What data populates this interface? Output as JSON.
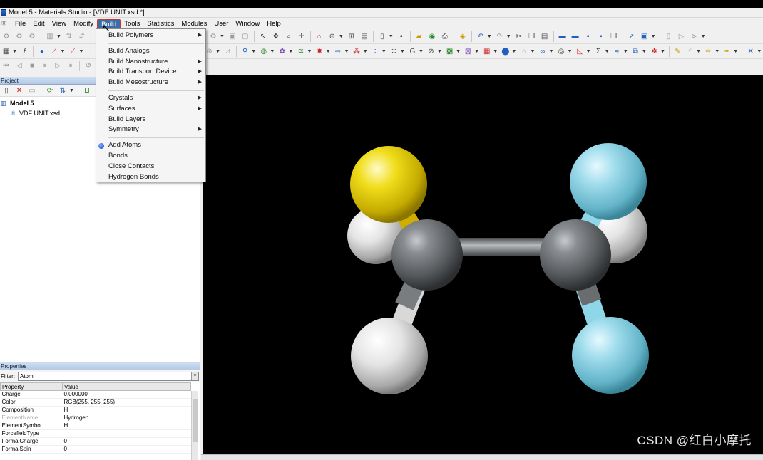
{
  "window": {
    "title": "Model 5 - Materials Studio - [VDF UNIT.xsd *]"
  },
  "menubar": {
    "items": [
      "File",
      "Edit",
      "View",
      "Modify",
      "Build",
      "Tools",
      "Statistics",
      "Modules",
      "User",
      "Window",
      "Help"
    ],
    "active": "Build"
  },
  "build_menu": {
    "items": [
      {
        "label": "Build Polymers",
        "submenu": true
      },
      {
        "label": "Build Analogs",
        "submenu": false
      },
      {
        "label": "Build Nanostructure",
        "submenu": true
      },
      {
        "label": "Build Transport Device",
        "submenu": true
      },
      {
        "label": "Build Mesostructure",
        "submenu": true
      },
      {
        "label": "Crystals",
        "submenu": true
      },
      {
        "label": "Surfaces",
        "submenu": true
      },
      {
        "label": "Build Layers",
        "submenu": false
      },
      {
        "label": "Symmetry",
        "submenu": true
      },
      {
        "label": "Add Atoms",
        "submenu": false
      },
      {
        "label": "Bonds",
        "submenu": false
      },
      {
        "label": "Close Contacts",
        "submenu": false
      },
      {
        "label": "Hydrogen Bonds",
        "submenu": false
      }
    ]
  },
  "project_panel": {
    "title": "Project",
    "tree": {
      "root": "Model 5",
      "children": [
        "VDF UNIT.xsd"
      ]
    }
  },
  "properties_panel": {
    "title": "Properties",
    "filter_label": "Filter:",
    "filter_value": "Atom",
    "columns": [
      "Property",
      "Value"
    ],
    "rows": [
      {
        "property": "Charge",
        "value": "0.000000"
      },
      {
        "property": "Color",
        "value": "RGB(255, 255, 255)"
      },
      {
        "property": "Composition",
        "value": "H"
      },
      {
        "property": "ElementName",
        "value": "Hydrogen",
        "greyed": true
      },
      {
        "property": "ElementSymbol",
        "value": "H"
      },
      {
        "property": "ForcefieldType",
        "value": ""
      },
      {
        "property": "FormalCharge",
        "value": "0"
      },
      {
        "property": "FormalSpin",
        "value": "0"
      }
    ]
  },
  "watermark": "CSDN @红白小摩托",
  "colors": {
    "viewer_background": "#000000",
    "carbon": "#5f6366",
    "hydrogen": "#e6e6e6",
    "fluorine": "#8fd6e8",
    "selected_atom": "#e6cc00",
    "menu_highlight": "#3a6ea5"
  }
}
